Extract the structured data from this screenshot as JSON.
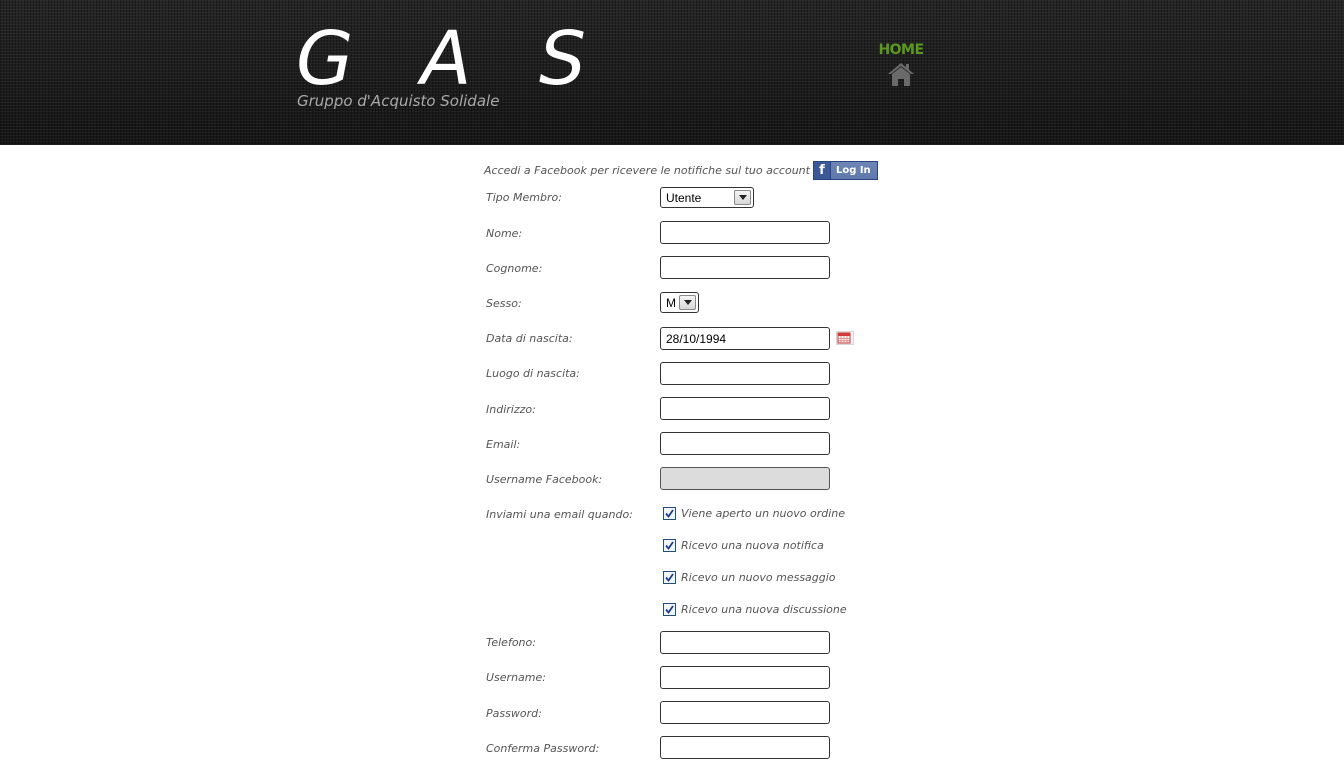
{
  "header": {
    "title": "G A S",
    "subtitle": "Gruppo d'Acquisto Solidale",
    "nav_home_label": "HOME",
    "home_icon": "home-icon"
  },
  "facebook": {
    "prompt": "Accedi a Facebook per ricevere le notifiche sul tuo account",
    "icon_glyph": "f",
    "button_label": "Log In"
  },
  "form": {
    "tipo_membro": {
      "label": "Tipo Membro:",
      "value": "Utente"
    },
    "nome": {
      "label": "Nome:",
      "value": ""
    },
    "cognome": {
      "label": "Cognome:",
      "value": ""
    },
    "sesso": {
      "label": "Sesso:",
      "value": "M"
    },
    "data_nascita": {
      "label": "Data di nascita:",
      "value": "28/10/1994",
      "icon": "calendar-icon"
    },
    "luogo_nascita": {
      "label": "Luogo di nascita:",
      "value": ""
    },
    "indirizzo": {
      "label": "Indirizzo:",
      "value": ""
    },
    "email": {
      "label": "Email:",
      "value": ""
    },
    "username_facebook": {
      "label": "Username Facebook:",
      "value": ""
    },
    "notifiche": {
      "label": "Inviami una email quando:",
      "options": [
        {
          "label": "Viene aperto un nuovo ordine",
          "checked": true
        },
        {
          "label": "Ricevo una nuova notifica",
          "checked": true
        },
        {
          "label": "Ricevo un nuovo messaggio",
          "checked": true
        },
        {
          "label": "Ricevo una nuova discussione",
          "checked": true
        }
      ]
    },
    "telefono": {
      "label": "Telefono:",
      "value": ""
    },
    "username": {
      "label": "Username:",
      "value": ""
    },
    "password": {
      "label": "Password:",
      "value": ""
    },
    "conferma_password": {
      "label": "Conferma Password:",
      "value": ""
    }
  },
  "colors": {
    "header_bg": "#1c1c1c",
    "home_green": "#5a9a1e",
    "label_gray": "#555555",
    "facebook_blue": "#3b5998"
  }
}
